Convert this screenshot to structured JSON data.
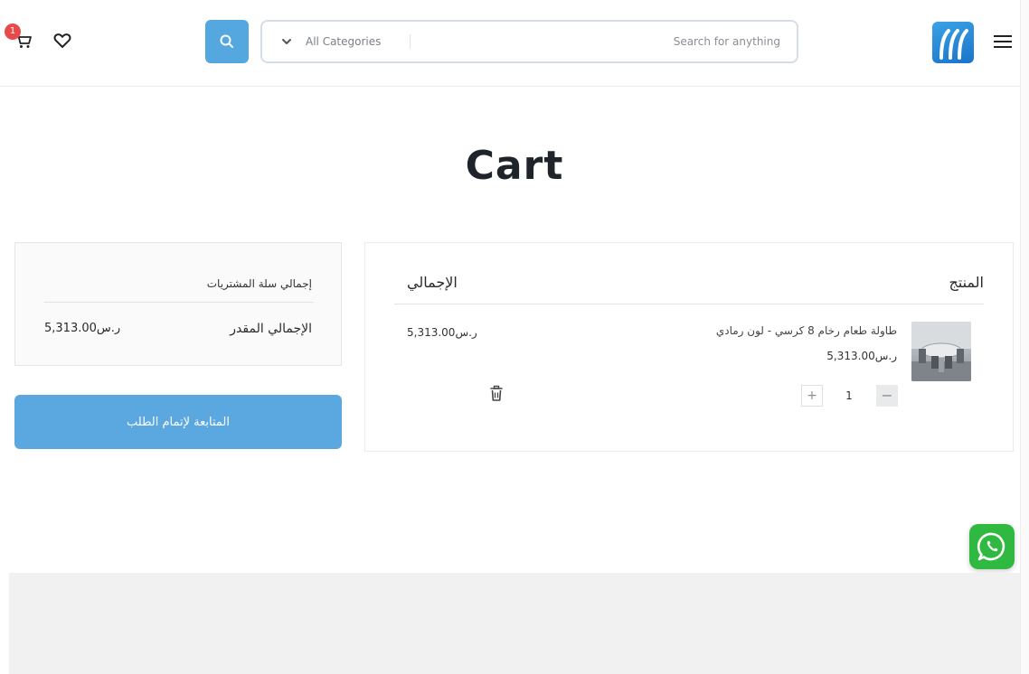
{
  "header": {
    "cart_count": "1",
    "search_placeholder": "Search for anything",
    "category_label": "All Categories",
    "search_value": ""
  },
  "page": {
    "title": "Cart"
  },
  "cart_table": {
    "col_product": "المنتج",
    "col_total": "الإجمالي",
    "items": [
      {
        "name": "طاولة طعام رخام 8 كرسي - لون رمادي",
        "price": "5,313.00ر.س",
        "quantity": "1",
        "total": "5,313.00ر.س"
      }
    ]
  },
  "totals": {
    "title": "إجمالي سلة المشتريات",
    "estimated_label": "الإجمالي المقدر",
    "estimated_value": "5,313.00ر.س"
  },
  "checkout": {
    "label": "المتابعة لإتمام الطلب"
  },
  "colors": {
    "accent": "#55a7e0",
    "badge": "#e84a4a",
    "whatsapp": "#2fb940"
  },
  "icons": {
    "cart": "cart-icon",
    "wishlist": "heart-icon",
    "search": "search-icon",
    "dropdown": "chevron-down-icon",
    "menu": "hamburger-menu-icon",
    "delete": "trash-icon",
    "whatsapp": "whatsapp-icon"
  }
}
